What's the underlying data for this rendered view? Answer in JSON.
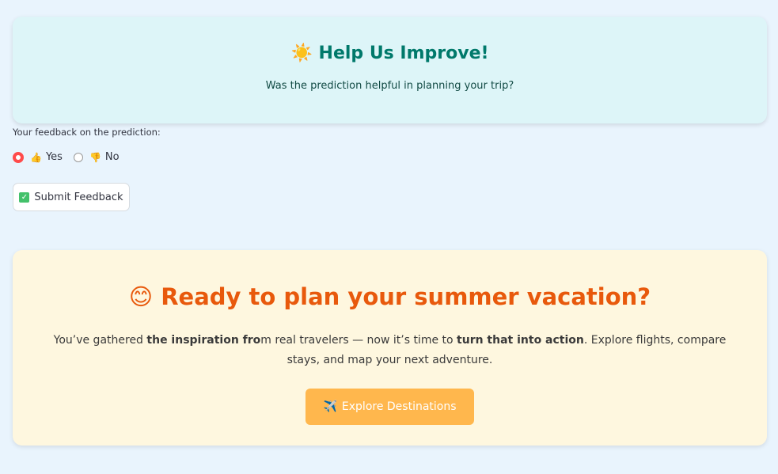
{
  "feedback_card": {
    "icon": "☀️",
    "title": "Help Us Improve!",
    "subtitle": "Was the prediction helpful in planning your trip?"
  },
  "feedback_form": {
    "label": "Your feedback on the prediction:",
    "options": [
      {
        "icon": "👍",
        "label": "Yes",
        "selected": true
      },
      {
        "icon": "👎",
        "label": "No",
        "selected": false
      }
    ],
    "submit_icon": "✓",
    "submit_label": "Submit Feedback"
  },
  "cta_card": {
    "icon": "😊",
    "title": "Ready to plan your summer vacation?",
    "text": [
      "You’ve gathered ",
      "the inspiration fro",
      "m real travelers — now it’s time to ",
      "turn that into action",
      ". Explore flights, compare stays, and map your next adventure."
    ],
    "button_icon": "✈️",
    "button_label": "Explore Destinations"
  },
  "colors": {
    "accent_red": "#ff4b4b",
    "teal": "#00796b",
    "orange": "#e8590c",
    "button_orange": "#ffb74d"
  }
}
